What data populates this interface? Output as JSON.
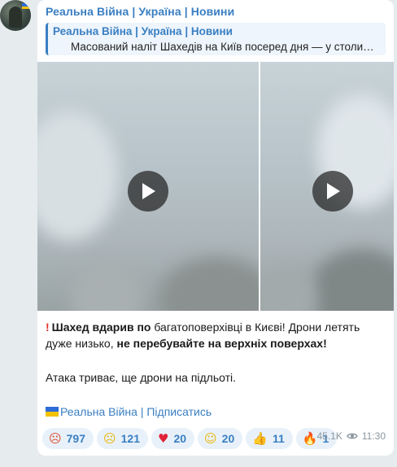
{
  "channel": {
    "name": "Реальна Війна | Україна | Новини"
  },
  "reply": {
    "title": "Реальна Війна | Україна | Новини",
    "text": "Масований наліт Шахедів на Київ посеред дня — у столи…"
  },
  "message": {
    "line1_bold": "Шахед вдарив по",
    "line1_rest": " багатоповерхівці в Києві! Дрони летять",
    "line2_pre": "дуже низько, ",
    "line2_bold": "не перебувайте на верхніх поверхах!",
    "line3": "Атака триває, ще дрони на підльоті.",
    "link": "Реальна Війна | Підписатись"
  },
  "reactions": [
    {
      "icon": "angry-face-icon",
      "count": "797"
    },
    {
      "icon": "crying-face-icon",
      "count": "121"
    },
    {
      "icon": "heart-icon",
      "count": "20"
    },
    {
      "icon": "grinning-face-icon",
      "count": "20"
    },
    {
      "icon": "thumbs-up-icon",
      "count": "11"
    },
    {
      "icon": "fire-icon",
      "count": "1"
    }
  ],
  "meta": {
    "views": "45.1K",
    "time": "11:30"
  },
  "colors": {
    "accent": "#3a7fc2",
    "background": "#e6ebee",
    "reaction_bg": "#e8f1fa"
  }
}
